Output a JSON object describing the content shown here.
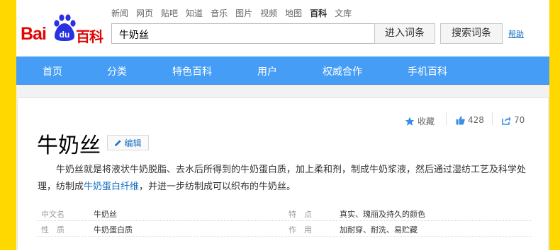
{
  "logo": {
    "bai": "Bai",
    "du": "du",
    "baike": "百科"
  },
  "topnav": [
    "新闻",
    "网页",
    "贴吧",
    "知道",
    "音乐",
    "图片",
    "视频",
    "地图",
    "百科",
    "文库"
  ],
  "topnav_active": "百科",
  "search": {
    "value": "牛奶丝",
    "enter_label": "进入词条",
    "search_label": "搜索词条",
    "help_label": "帮助"
  },
  "mainnav": [
    "首页",
    "分类",
    "特色百科",
    "用户",
    "权威合作",
    "手机百科"
  ],
  "tools": {
    "collect_label": "收藏",
    "like_count": "428",
    "share_count": "70"
  },
  "entry": {
    "title": "牛奶丝",
    "edit_label": "编辑",
    "summary_part1": "牛奶丝就是将液状牛奶脱脂、去水后所得到的牛奶蛋白质，加上柔和剂，制成牛奶浆液，然后通过湿纺工艺及科学处理，纺制成",
    "summary_link": "牛奶蛋白纤维",
    "summary_part2": "，并进一步纺制成可以织布的牛奶丝。"
  },
  "info": [
    {
      "name1": "中文名",
      "value1": "牛奶丝",
      "name2": "特　点",
      "value2": "真实、瑰丽及持久的颜色"
    },
    {
      "name1": "性　质",
      "value1": "牛奶蛋白质",
      "name2": "作　用",
      "value2": "加耐穿、耐洗、易贮藏"
    }
  ],
  "colors": {
    "brand_red": "#e10602",
    "brand_blue": "#2932e1",
    "nav_blue": "#459df5",
    "link": "#136ec2",
    "frame": "#ffd800"
  }
}
